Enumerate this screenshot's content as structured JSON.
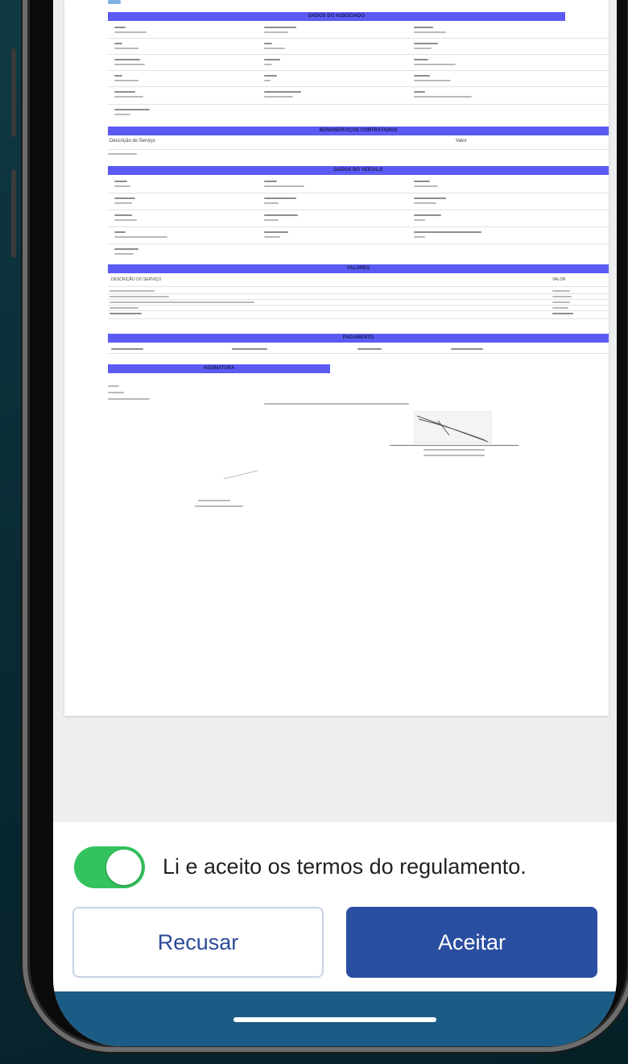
{
  "document": {
    "sections": [
      "DADOS DO ASSOCIADO",
      "BENS/SERVIÇOS CONTRATADOS",
      "DADOS DO VEÍCULO",
      "VALORES",
      "PAGAMENTO",
      "ASSINATURA"
    ],
    "service_col_left": "Descrição do Serviço",
    "service_col_right": "Valor",
    "values_col_left": "DESCRIÇÃO DO SERVIÇO",
    "values_col_right": "VALOR"
  },
  "terms": {
    "toggle_on": true,
    "label": "Li e aceito os termos do regulamento."
  },
  "actions": {
    "refuse_label": "Recusar",
    "accept_label": "Aceitar"
  },
  "colors": {
    "section_bar": "#5b5bf4",
    "toggle_on": "#33c25e",
    "accept_button": "#2a4ea0",
    "refuse_text": "#2c4a9a",
    "footer_band": "#1b5c86"
  }
}
